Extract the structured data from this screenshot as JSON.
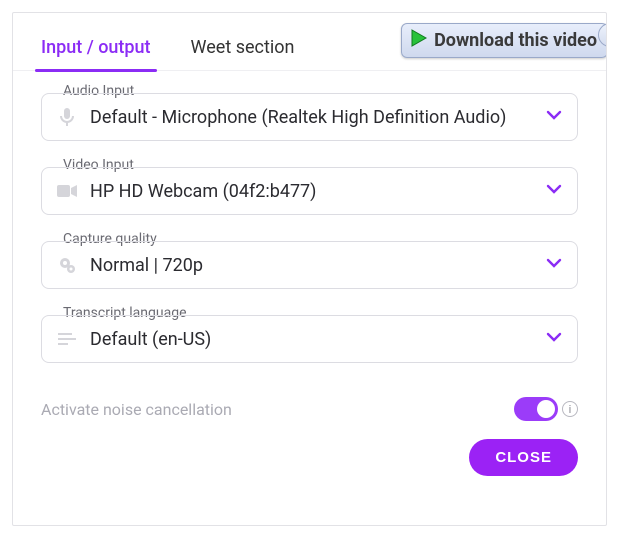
{
  "tabs": {
    "input_output": "Input / output",
    "weet_section": "Weet section"
  },
  "download_label": "Download this video",
  "fields": {
    "audio": {
      "label": "Audio Input",
      "value": "Default - Microphone (Realtek High Definition Audio)"
    },
    "video": {
      "label": "Video Input",
      "value": "HP HD Webcam (04f2:b477)"
    },
    "quality": {
      "label": "Capture quality",
      "value": "Normal | 720p"
    },
    "transcript": {
      "label": "Transcript language",
      "value": "Default (en-US)"
    }
  },
  "noise_cancel_label": "Activate noise cancellation",
  "close_label": "CLOSE",
  "help_glyph": "?",
  "info_glyph": "i"
}
